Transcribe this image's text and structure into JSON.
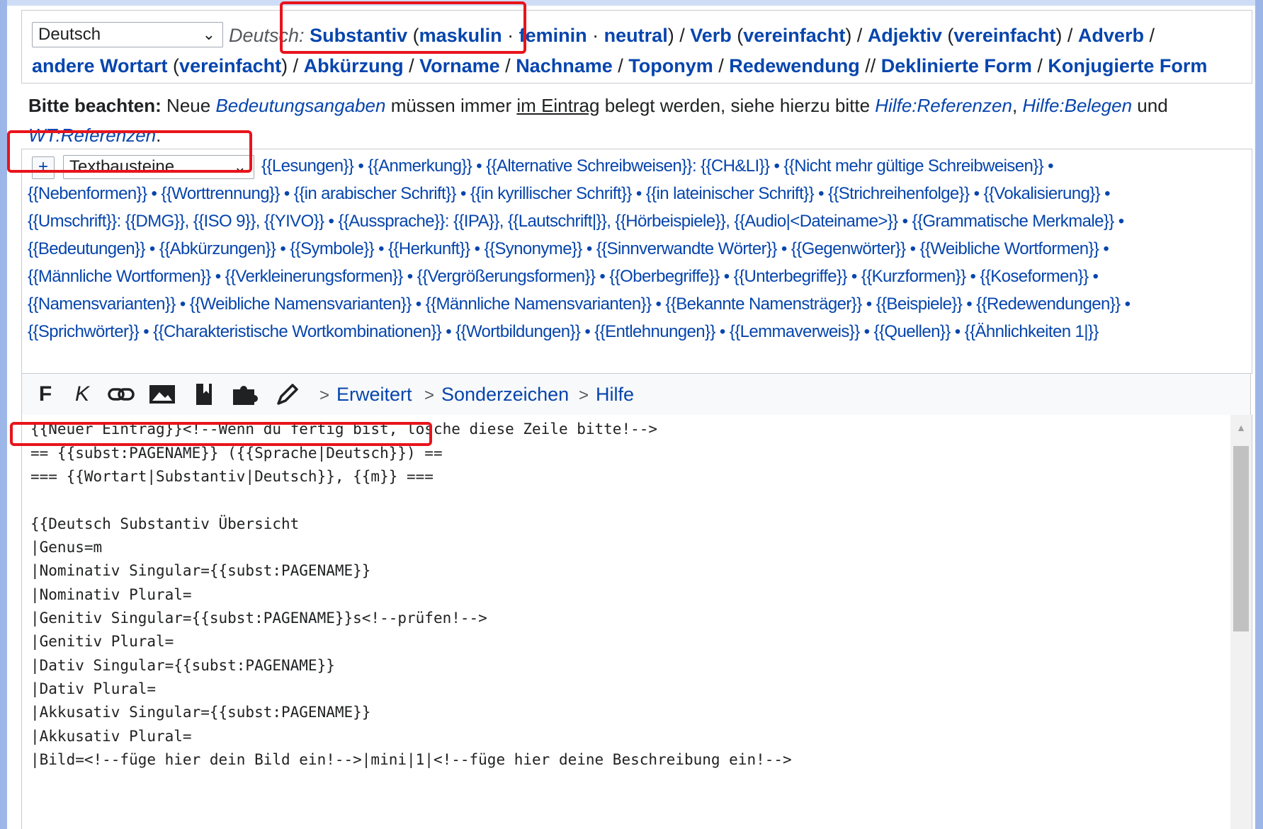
{
  "language_select": {
    "value": "Deutsch"
  },
  "wortart": {
    "prefix": "Deutsch:",
    "substantiv": "Substantiv",
    "maskulin": "maskulin",
    "feminin": "feminin",
    "neutral": "neutral",
    "verb": "Verb",
    "verb_vereinfacht": "vereinfacht",
    "adjektiv": "Adjektiv",
    "adjektiv_vereinfacht": "vereinfacht",
    "adverb": "Adverb",
    "andere_wortart": "andere Wortart",
    "andere_vereinfacht": "vereinfacht",
    "abkuerzung": "Abkürzung",
    "vorname": "Vorname",
    "nachname": "Nachname",
    "toponym": "Toponym",
    "redewendung": "Redewendung",
    "deklinierte_form": "Deklinierte Form",
    "konjugierte_form": "Konjugierte Form"
  },
  "notice": {
    "lead": "Bitte beachten:",
    "t1": "Neue",
    "link1": "Bedeutungsangaben",
    "t2": "müssen immer",
    "link2": "im Eintrag",
    "t3": "belegt werden, siehe hierzu bitte",
    "link3": "Hilfe:Referenzen",
    "link4": "Hilfe:Belegen",
    "t4": "und",
    "link5": "WT:Referenzen",
    "t5": "."
  },
  "templates": {
    "plus_label": "+",
    "select_value": "Textbausteine",
    "lines": [
      "{{Lesungen}} • {{Anmerkung}} • {{Alternative Schreibweisen}}: {{CH&LI}} • {{Nicht mehr gültige Schreibweisen}} •",
      "{{Nebenformen}} • {{Worttrennung}} • {{in arabischer Schrift}} • {{in kyrillischer Schrift}} • {{in lateinischer Schrift}} • {{Strichreihenfolge}} • {{Vokalisierung}} •",
      "{{Umschrift}}: {{DMG}}, {{ISO 9}}, {{YIVO}} • {{Aussprache}}: {{IPA}}, {{Lautschrift|}}, {{Hörbeispiele}}, {{Audio|<Dateiname>}} • {{Grammatische Merkmale}} •",
      "{{Bedeutungen}} • {{Abkürzungen}} • {{Symbole}} • {{Herkunft}} • {{Synonyme}} • {{Sinnverwandte Wörter}} • {{Gegenwörter}} • {{Weibliche Wortformen}} •",
      "{{Männliche Wortformen}} • {{Verkleinerungsformen}} • {{Vergrößerungsformen}} • {{Oberbegriffe}} • {{Unterbegriffe}} • {{Kurzformen}} • {{Koseformen}} •",
      "{{Namensvarianten}} • {{Weibliche Namensvarianten}} • {{Männliche Namensvarianten}} • {{Bekannte Namensträger}} • {{Beispiele}} • {{Redewendungen}} •",
      "{{Sprichwörter}} • {{Charakteristische Wortkombinationen}} • {{Wortbildungen}} • {{Entlehnungen}} • {{Lemmaverweis}} • {{Quellen}} • {{Ähnlichkeiten 1|}}"
    ]
  },
  "toolbar": {
    "bold": "F",
    "italic": "K",
    "erweitert": "Erweitert",
    "sonderzeichen": "Sonderzeichen",
    "hilfe": "Hilfe"
  },
  "editor": {
    "lines": [
      "{{Neuer Eintrag}}<!--Wenn du fertig bist, lösche diese Zeile bitte!-->",
      "== {{subst:PAGENAME}} ({{Sprache|Deutsch}}) ==",
      "=== {{Wortart|Substantiv|Deutsch}}, {{m}} ===",
      "",
      "{{Deutsch Substantiv Übersicht",
      "|Genus=m",
      "|Nominativ Singular={{subst:PAGENAME}}",
      "|Nominativ Plural=",
      "|Genitiv Singular={{subst:PAGENAME}}s<!--prüfen!-->",
      "|Genitiv Plural=",
      "|Dativ Singular={{subst:PAGENAME}}",
      "|Dativ Plural=",
      "|Akkusativ Singular={{subst:PAGENAME}}",
      "|Akkusativ Plural=",
      "|Bild=<!--füge hier dein Bild ein!-->|mini|1|<!--füge hier deine Beschreibung ein!-->"
    ]
  },
  "colors": {
    "link": "#0645ad",
    "highlight": "#e8141c",
    "border": "#c8ccd1"
  }
}
